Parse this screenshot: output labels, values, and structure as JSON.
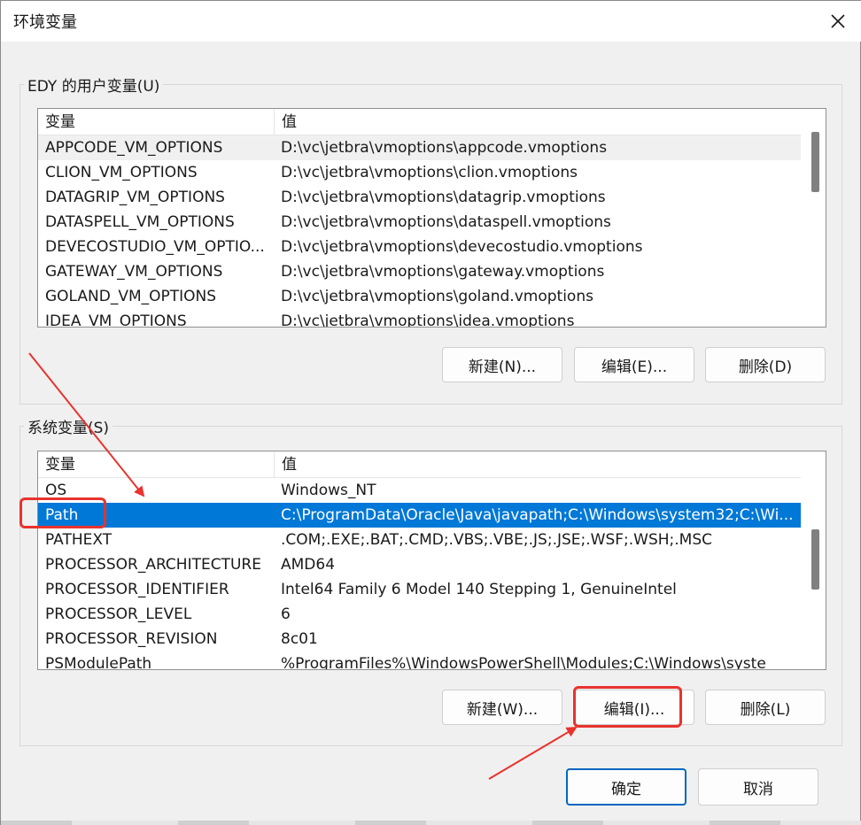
{
  "window": {
    "title": "环境变量",
    "close_icon": "close-icon"
  },
  "user_group": {
    "label": "EDY 的用户变量(U)",
    "columns": [
      "变量",
      "值"
    ],
    "rows": [
      {
        "name": "APPCODE_VM_OPTIONS",
        "value": "D:\\vc\\jetbra\\vmoptions\\appcode.vmoptions"
      },
      {
        "name": "CLION_VM_OPTIONS",
        "value": "D:\\vc\\jetbra\\vmoptions\\clion.vmoptions"
      },
      {
        "name": "DATAGRIP_VM_OPTIONS",
        "value": "D:\\vc\\jetbra\\vmoptions\\datagrip.vmoptions"
      },
      {
        "name": "DATASPELL_VM_OPTIONS",
        "value": "D:\\vc\\jetbra\\vmoptions\\dataspell.vmoptions"
      },
      {
        "name": "DEVECOSTUDIO_VM_OPTIO...",
        "value": "D:\\vc\\jetbra\\vmoptions\\devecostudio.vmoptions"
      },
      {
        "name": "GATEWAY_VM_OPTIONS",
        "value": "D:\\vc\\jetbra\\vmoptions\\gateway.vmoptions"
      },
      {
        "name": "GOLAND_VM_OPTIONS",
        "value": "D:\\vc\\jetbra\\vmoptions\\goland.vmoptions"
      },
      {
        "name": "IDEA_VM_OPTIONS",
        "value": "D:\\vc\\jetbra\\vmoptions\\idea.vmoptions"
      }
    ],
    "buttons": {
      "new": "新建(N)...",
      "edit": "编辑(E)...",
      "delete": "删除(D)"
    }
  },
  "system_group": {
    "label": "系统变量(S)",
    "columns": [
      "变量",
      "值"
    ],
    "rows": [
      {
        "name": "OS",
        "value": "Windows_NT"
      },
      {
        "name": "Path",
        "value": "C:\\ProgramData\\Oracle\\Java\\javapath;C:\\Windows\\system32;C:\\Wi..."
      },
      {
        "name": "PATHEXT",
        "value": ".COM;.EXE;.BAT;.CMD;.VBS;.VBE;.JS;.JSE;.WSF;.WSH;.MSC"
      },
      {
        "name": "PROCESSOR_ARCHITECTURE",
        "value": "AMD64"
      },
      {
        "name": "PROCESSOR_IDENTIFIER",
        "value": "Intel64 Family 6 Model 140 Stepping 1, GenuineIntel"
      },
      {
        "name": "PROCESSOR_LEVEL",
        "value": "6"
      },
      {
        "name": "PROCESSOR_REVISION",
        "value": "8c01"
      },
      {
        "name": "PSModulePath",
        "value": "%ProgramFiles%\\WindowsPowerShell\\Modules;C:\\Windows\\syste"
      }
    ],
    "selected_row": "Path",
    "buttons": {
      "new": "新建(W)...",
      "edit": "编辑(I)...",
      "delete": "删除(L)"
    }
  },
  "footer": {
    "ok": "确定",
    "cancel": "取消"
  },
  "colors": {
    "selection": "#0078d7",
    "annotation": "#e8332e",
    "default_button_border": "#0067c0"
  }
}
